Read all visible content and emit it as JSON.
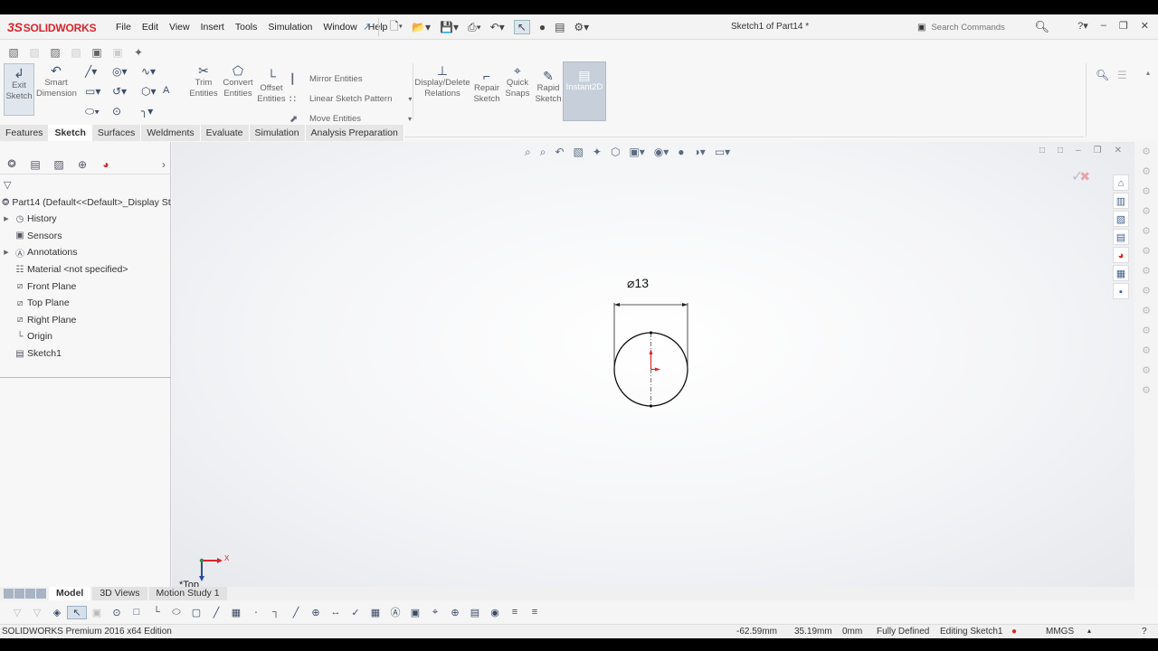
{
  "app": {
    "logo_ds": "3S",
    "logo_text": "SOLIDWORKS",
    "document_title": "Sketch1 of Part14 *"
  },
  "menu": [
    "File",
    "Edit",
    "View",
    "Insert",
    "Tools",
    "Simulation",
    "Window",
    "Help"
  ],
  "search": {
    "placeholder": "Search Commands"
  },
  "commands": {
    "exit_sketch": "Exit Sketch",
    "smart_dimension": "Smart Dimension",
    "trim_entities": "Trim Entities",
    "convert_entities": "Convert Entities",
    "offset_entities": "Offset Entities",
    "mirror_entities": "Mirror Entities",
    "linear_sketch_pattern": "Linear Sketch Pattern",
    "move_entities": "Move Entities",
    "display_delete_relations": "Display/Delete Relations",
    "repair_sketch": "Repair Sketch",
    "quick_snaps": "Quick Snaps",
    "rapid_sketch": "Rapid Sketch",
    "instant2d": "Instant2D"
  },
  "tabs": [
    "Features",
    "Sketch",
    "Surfaces",
    "Weldments",
    "Evaluate",
    "Simulation",
    "Analysis Preparation"
  ],
  "active_tab": "Sketch",
  "feature_tree": {
    "root": "Part14  (Default<<Default>_Display St",
    "items": [
      {
        "label": "History",
        "expandable": true,
        "icon": "history-icon"
      },
      {
        "label": "Sensors",
        "expandable": false,
        "icon": "sensor-icon"
      },
      {
        "label": "Annotations",
        "expandable": true,
        "icon": "annotation-icon"
      },
      {
        "label": "Material <not specified>",
        "expandable": false,
        "icon": "material-icon"
      },
      {
        "label": "Front Plane",
        "expandable": false,
        "icon": "plane-icon"
      },
      {
        "label": "Top Plane",
        "expandable": false,
        "icon": "plane-icon"
      },
      {
        "label": "Right Plane",
        "expandable": false,
        "icon": "plane-icon"
      },
      {
        "label": "Origin",
        "expandable": false,
        "icon": "origin-icon"
      },
      {
        "label": "Sketch1",
        "expandable": false,
        "icon": "sketch-icon"
      }
    ]
  },
  "sketch": {
    "dimension": "⌀13",
    "view_name": "*Top",
    "x_axis": "X"
  },
  "model_tabs": [
    "Model",
    "3D Views",
    "Motion Study 1"
  ],
  "active_model_tab": "Model",
  "status": {
    "edition": "SOLIDWORKS Premium 2016 x64 Edition",
    "x": "-62.59mm",
    "y": "35.19mm",
    "z": "0mm",
    "definition": "Fully Defined",
    "mode": "Editing Sketch1",
    "units": "MMGS"
  },
  "colors": {
    "brand": "#d8262c",
    "highlight": "#dfe6ee"
  }
}
